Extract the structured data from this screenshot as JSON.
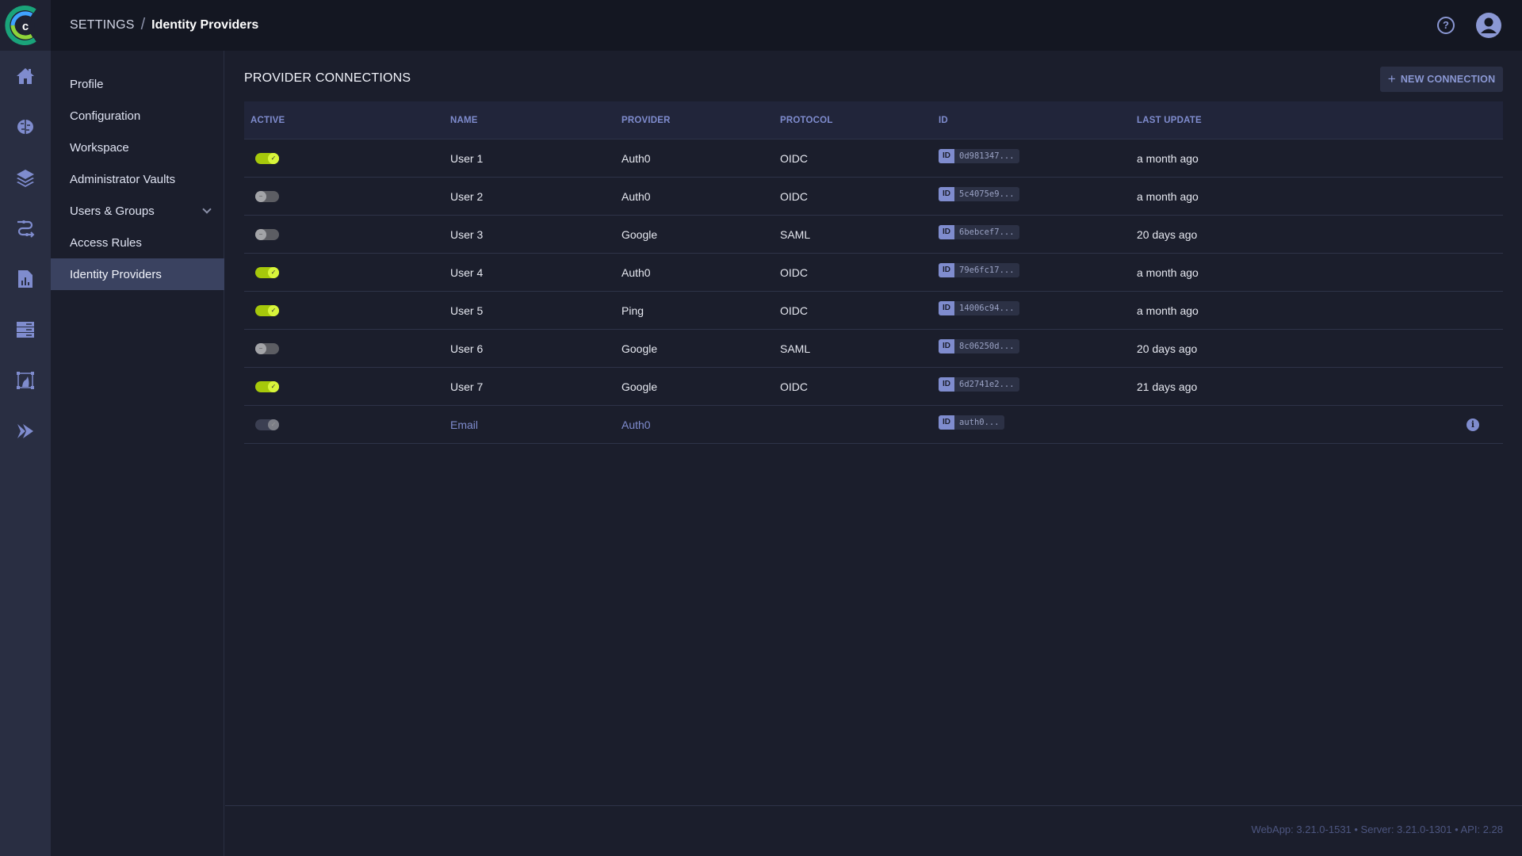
{
  "header": {
    "breadcrumb_root": "SETTINGS",
    "breadcrumb_sep": "/",
    "breadcrumb_current": "Identity Providers",
    "help_icon": "question-circle-icon",
    "avatar_icon": "user-avatar-icon"
  },
  "rail": {
    "icons": [
      "home-icon",
      "brain-icon",
      "layers-icon",
      "pipelines-icon",
      "report-icon",
      "servers-icon",
      "dataset-icon",
      "deploy-icon"
    ]
  },
  "submenu": {
    "items": [
      {
        "label": "Profile"
      },
      {
        "label": "Configuration"
      },
      {
        "label": "Workspace"
      },
      {
        "label": "Administrator Vaults"
      },
      {
        "label": "Users & Groups",
        "expandable": true
      },
      {
        "label": "Access Rules"
      },
      {
        "label": "Identity Providers",
        "active": true
      }
    ]
  },
  "main": {
    "title": "PROVIDER CONNECTIONS",
    "new_button": "NEW CONNECTION",
    "columns": [
      "ACTIVE",
      "NAME",
      "PROVIDER",
      "PROTOCOL",
      "ID",
      "LAST UPDATE"
    ],
    "rows": [
      {
        "active": "on",
        "name": "User 1",
        "provider": "Auth0",
        "protocol": "OIDC",
        "id": "0d981347...",
        "updated": "a month ago"
      },
      {
        "active": "off",
        "name": "User 2",
        "provider": "Auth0",
        "protocol": "OIDC",
        "id": "5c4075e9...",
        "updated": "a month ago"
      },
      {
        "active": "off",
        "name": "User 3",
        "provider": "Google",
        "protocol": "SAML",
        "id": "6bebcef7...",
        "updated": "20 days ago"
      },
      {
        "active": "on",
        "name": "User 4",
        "provider": "Auth0",
        "protocol": "OIDC",
        "id": "79e6fc17...",
        "updated": "a month ago"
      },
      {
        "active": "on",
        "name": "User 5",
        "provider": "Ping",
        "protocol": "OIDC",
        "id": "14006c94...",
        "updated": "a month ago"
      },
      {
        "active": "off",
        "name": "User 6",
        "provider": "Google",
        "protocol": "SAML",
        "id": "8c06250d...",
        "updated": "20 days ago"
      },
      {
        "active": "on",
        "name": "User 7",
        "provider": "Google",
        "protocol": "OIDC",
        "id": "6d2741e2...",
        "updated": "21 days ago"
      },
      {
        "active": "disabled",
        "name": "Email",
        "provider": "Auth0",
        "protocol": "",
        "id": "auth0...",
        "updated": "",
        "muted": true,
        "info": true
      }
    ],
    "id_tag": "ID"
  },
  "footer": {
    "version": "WebApp: 3.21.0-1531 • Server: 3.21.0-1301 • API: 2.28"
  },
  "colors": {
    "accent": "#7f8cce",
    "toggle_on": "#a6c80b",
    "background": "#1b1e2c"
  }
}
